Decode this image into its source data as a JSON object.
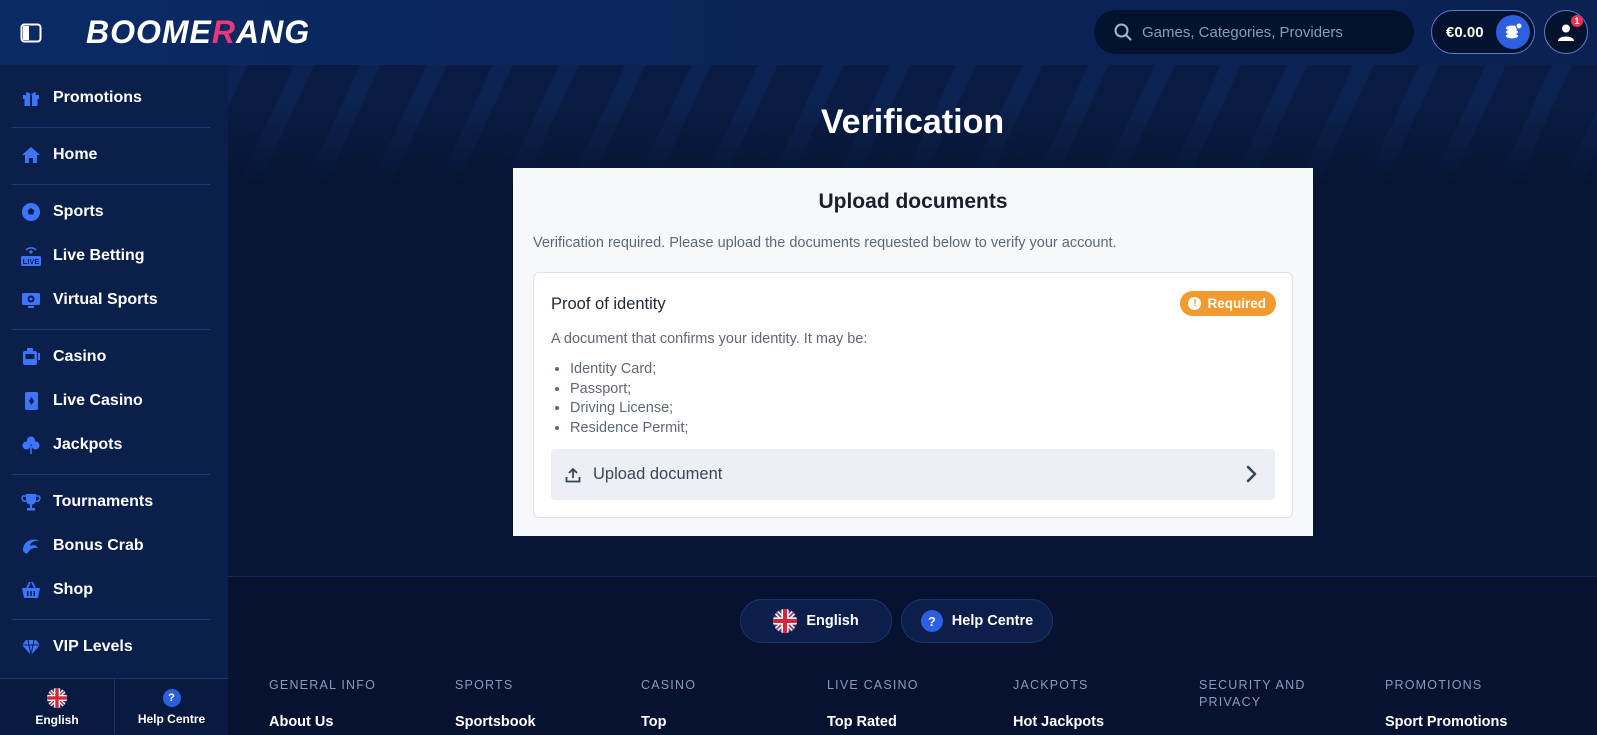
{
  "header": {
    "logo_text_a": "BOOME",
    "logo_text_r": "R",
    "logo_text_b": "ANG",
    "search_placeholder": "Games, Categories, Providers",
    "balance": "€0.00",
    "notification_count": "1"
  },
  "sidebar": {
    "items": [
      {
        "label": "Promotions",
        "icon": "gift-icon"
      },
      {
        "label": "Home",
        "icon": "home-icon"
      },
      {
        "label": "Sports",
        "icon": "soccer-ball-icon"
      },
      {
        "label": "Live Betting",
        "icon": "live-icon"
      },
      {
        "label": "Virtual Sports",
        "icon": "virtual-screen-icon"
      },
      {
        "label": "Casino",
        "icon": "slot-machine-icon"
      },
      {
        "label": "Live Casino",
        "icon": "playing-card-icon"
      },
      {
        "label": "Jackpots",
        "icon": "clover-icon"
      },
      {
        "label": "Tournaments",
        "icon": "trophy-icon"
      },
      {
        "label": "Bonus Crab",
        "icon": "claw-icon"
      },
      {
        "label": "Shop",
        "icon": "basket-icon"
      },
      {
        "label": "VIP Levels",
        "icon": "diamond-icon"
      }
    ],
    "live_badge": "LIVE",
    "footer": {
      "language": "English",
      "help": "Help Centre"
    }
  },
  "main": {
    "title": "Verification",
    "card": {
      "heading": "Upload documents",
      "intro": "Verification required. Please upload the documents requested below to verify your account.",
      "document": {
        "title": "Proof of identity",
        "status": "Required",
        "description": "A document that confirms your identity. It may be:",
        "options": [
          "Identity Card;",
          "Passport;",
          "Driving License;",
          "Residence Permit;"
        ],
        "upload_label": "Upload document"
      }
    }
  },
  "footer": {
    "language": "English",
    "help": "Help Centre",
    "columns": [
      {
        "heading": "GENERAL INFO",
        "link": "About Us"
      },
      {
        "heading": "SPORTS",
        "link": "Sportsbook"
      },
      {
        "heading": "CASINO",
        "link": "Top"
      },
      {
        "heading": "LIVE CASINO",
        "link": "Top Rated"
      },
      {
        "heading": "JACKPOTS",
        "link": "Hot Jackpots"
      },
      {
        "heading": "SECURITY AND PRIVACY",
        "link": ""
      },
      {
        "heading": "PROMOTIONS",
        "link": "Sport Promotions"
      }
    ]
  },
  "colors": {
    "accent": "#2d5fe0",
    "required": "#f29a2e",
    "logo_r": "#e83a7a"
  }
}
